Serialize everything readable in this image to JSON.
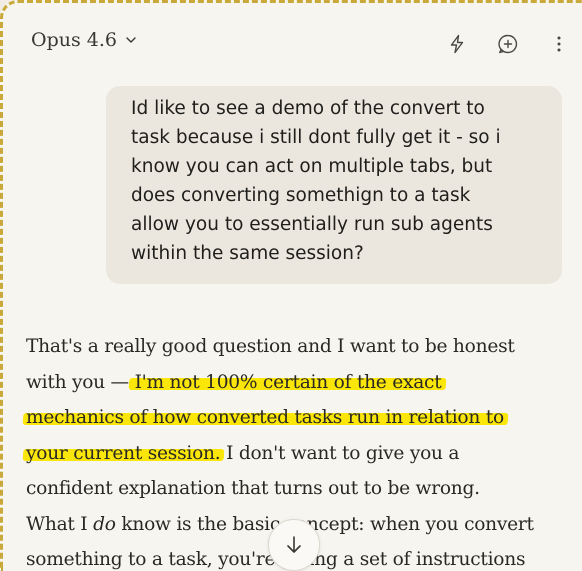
{
  "header": {
    "model_name": "Opus 4.6",
    "icons": [
      "chevron-down-icon",
      "lightning-icon",
      "new-chat-icon",
      "more-options-icon"
    ]
  },
  "user_message": {
    "lines": [
      "Id like to see a demo of the convert to",
      "task because i still dont fully get it - so i",
      "know you can act on multiple tabs, but",
      "does converting somethign to a task",
      "allow you to essentially run sub agents",
      "within the same session?"
    ]
  },
  "assistant_message": {
    "line1": "That's a really good question and I want to be honest",
    "line2_plain": "with you — ",
    "line2_highlight": "I'm not 100% certain of the exact",
    "line3_highlight": "mechanics of how converted tasks run in relation to",
    "line4_highlight": "your current session.",
    "line4_plain": " I don't want to give you a",
    "line5": "confident explanation that turns out to be wrong.",
    "line6_a": "What I ",
    "line6_em": "do",
    "line6_b": " know is the basic concept: when you convert",
    "line7": "something to a task, you're giving a set of instructions"
  },
  "colors": {
    "highlight": "#fbe60a",
    "background": "#f7f5f0",
    "bubble": "#ebe7de"
  }
}
